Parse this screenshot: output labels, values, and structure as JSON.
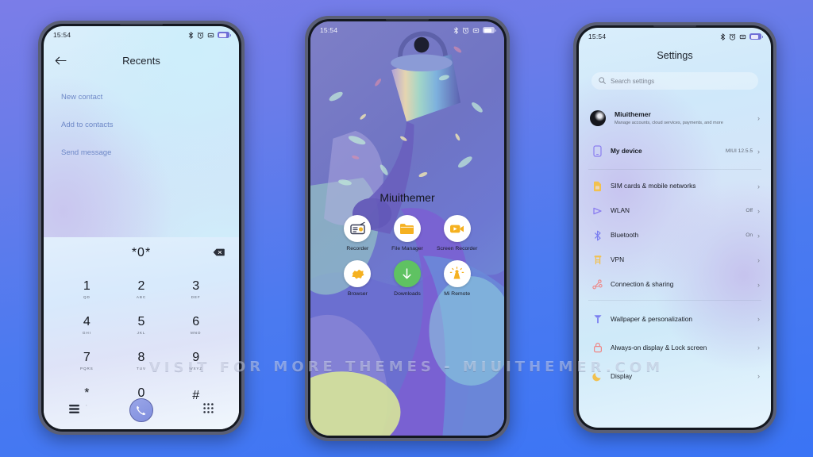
{
  "background": {
    "gradient_from": "#7b7de8",
    "gradient_to": "#3a74f5"
  },
  "watermark": {
    "text": "VISIT FOR MORE THEMES - MIUITHEMER.COM"
  },
  "status_bar": {
    "time": "15:54",
    "icons": [
      "bluetooth-icon",
      "alarm-icon",
      "vibrate-icon",
      "battery-icon"
    ]
  },
  "phone_dialer": {
    "appbar": {
      "back": "back-arrow-icon",
      "title": "Recents"
    },
    "links": [
      {
        "label": "New contact"
      },
      {
        "label": "Add to contacts"
      },
      {
        "label": "Send message"
      }
    ],
    "dialed_number": "*0*",
    "delete_icon": "backspace-icon",
    "keys": [
      {
        "num": "1",
        "sub": "QD"
      },
      {
        "num": "2",
        "sub": "ABC"
      },
      {
        "num": "3",
        "sub": "DEF"
      },
      {
        "num": "4",
        "sub": "GHI"
      },
      {
        "num": "5",
        "sub": "JKL"
      },
      {
        "num": "6",
        "sub": "MNO"
      },
      {
        "num": "7",
        "sub": "PQRS"
      },
      {
        "num": "8",
        "sub": "TUV"
      },
      {
        "num": "9",
        "sub": "WXYZ"
      },
      {
        "num": "*",
        "sub": ","
      },
      {
        "num": "0",
        "sub": "+"
      },
      {
        "num": "#",
        "sub": ""
      }
    ],
    "nav": {
      "list_icon": "contacts-list-icon",
      "call_icon": "call-handset-icon",
      "keypad_icon": "keypad-grid-icon"
    }
  },
  "phone_home": {
    "wallpaper_name": "abstract-paint-bucket-wallpaper",
    "folder_label": "Miuithemer",
    "apps": [
      {
        "label": "Recorder",
        "icon": "recorder-icon",
        "color": "#f0b429"
      },
      {
        "label": "File Manager",
        "icon": "folder-icon",
        "color": "#f5b120"
      },
      {
        "label": "Screen Recorder",
        "icon": "video-camera-icon",
        "color": "#f5b120"
      },
      {
        "label": "Browser",
        "icon": "browser-map-icon",
        "color": "#f5b120"
      },
      {
        "label": "Downloads",
        "icon": "download-arrow-icon",
        "color": "#5fc262"
      },
      {
        "label": "Mi Remote",
        "icon": "remote-beacon-icon",
        "color": "#f5b120"
      }
    ]
  },
  "phone_settings": {
    "title": "Settings",
    "search": {
      "placeholder": "Search settings",
      "icon": "search-icon"
    },
    "account": {
      "name": "Miuithemer",
      "subtitle": "Manage accounts, cloud services, payments, and more",
      "avatar": "user-avatar"
    },
    "device": {
      "label": "My device",
      "value": "MIUI 12.5.5",
      "icon": "phone-icon",
      "color": "#8b7ef0"
    },
    "items": [
      {
        "label": "SIM cards & mobile networks",
        "value": "",
        "icon": "sim-card-icon",
        "color": "#f2c14e"
      },
      {
        "label": "WLAN",
        "value": "Off",
        "icon": "wifi-icon",
        "color": "#8b7ef0"
      },
      {
        "label": "Bluetooth",
        "value": "On",
        "icon": "bluetooth-icon",
        "color": "#7b7ff0"
      },
      {
        "label": "VPN",
        "value": "",
        "icon": "vpn-icon",
        "color": "#f2c14e"
      },
      {
        "label": "Connection & sharing",
        "value": "",
        "icon": "connection-share-icon",
        "color": "#ef8585"
      }
    ],
    "items2": [
      {
        "label": "Wallpaper & personalization",
        "value": "",
        "icon": "brush-icon",
        "color": "#7b7ff0"
      },
      {
        "label": "Always-on display & Lock screen",
        "value": "",
        "icon": "lock-icon",
        "color": "#ef8585"
      },
      {
        "label": "Display",
        "value": "",
        "icon": "moon-icon",
        "color": "#f2c14e"
      }
    ],
    "chevron": "›"
  }
}
